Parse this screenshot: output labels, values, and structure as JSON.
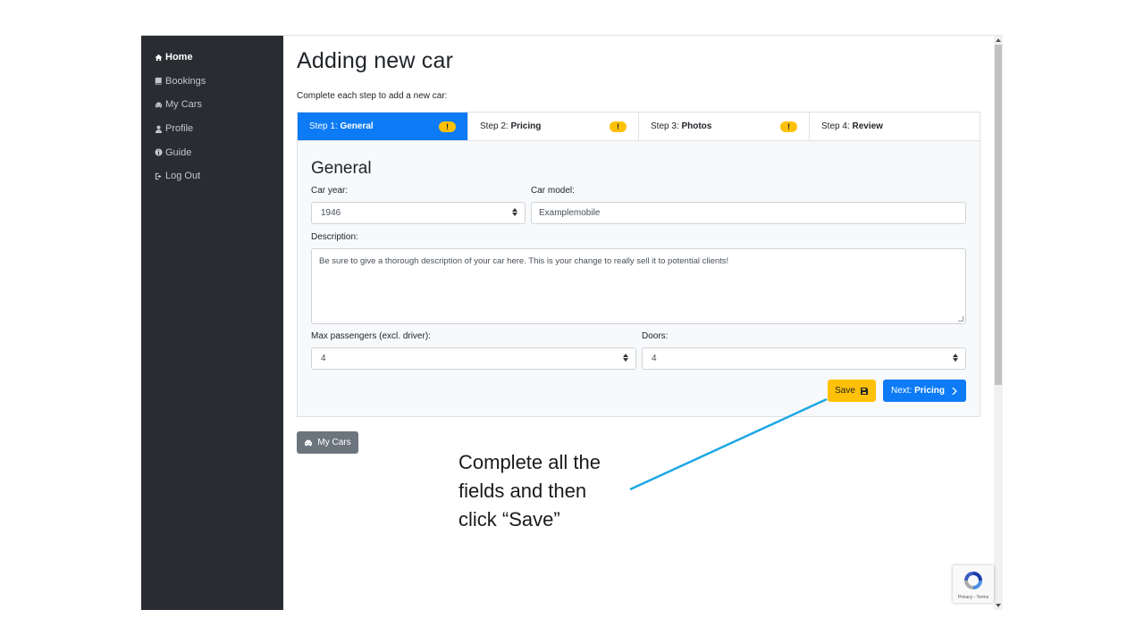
{
  "sidebar": {
    "items": [
      {
        "label": "Home",
        "icon": "home-icon"
      },
      {
        "label": "Bookings",
        "icon": "book-icon"
      },
      {
        "label": "My Cars",
        "icon": "car-icon"
      },
      {
        "label": "Profile",
        "icon": "user-icon"
      },
      {
        "label": "Guide",
        "icon": "info-icon"
      },
      {
        "label": "Log Out",
        "icon": "logout-icon"
      }
    ]
  },
  "page": {
    "title": "Adding new car",
    "subtitle": "Complete each step to add a new car:"
  },
  "steps": [
    {
      "prefix": "Step 1: ",
      "name": "General",
      "badge": "!"
    },
    {
      "prefix": "Step 2: ",
      "name": "Pricing",
      "badge": "!"
    },
    {
      "prefix": "Step 3: ",
      "name": "Photos",
      "badge": "!"
    },
    {
      "prefix": "Step 4: ",
      "name": "Review"
    }
  ],
  "form": {
    "title": "General",
    "car_year_label": "Car year:",
    "car_year_value": "1946",
    "car_model_label": "Car model:",
    "car_model_value": "Examplemobile",
    "description_label": "Description:",
    "description_value": "Be sure to give a thorough description of your car here. This is your change to really sell it to potential clients!",
    "passengers_label": "Max passengers (excl. driver):",
    "passengers_value": "4",
    "doors_label": "Doors:",
    "doors_value": "4",
    "save_label": "Save",
    "next_prefix": "Next: ",
    "next_name": "Pricing"
  },
  "back_button_label": "My Cars",
  "recaptcha_text": "Privacy - Terms",
  "annotation": {
    "line1": "Complete all the",
    "line2": "fields and then",
    "line3": "click “Save”"
  },
  "colors": {
    "sidebar_bg": "#292d32",
    "primary": "#0d7bf5",
    "warning": "#ffc107",
    "secondary": "#6c757d",
    "callout": "#1ea7e4"
  }
}
